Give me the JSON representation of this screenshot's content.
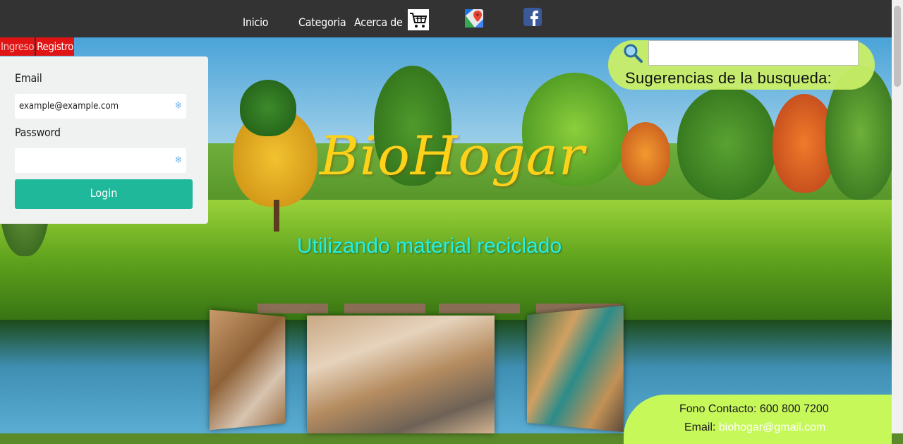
{
  "nav": {
    "items": [
      "Inicio",
      "Categoria",
      "Acerca de"
    ],
    "icons": [
      "cart-icon",
      "google-maps-icon",
      "facebook-icon"
    ]
  },
  "login": {
    "tabs": [
      "Ingreso",
      "Registro"
    ],
    "email_label": "Email",
    "email_value": "example@example.com",
    "password_label": "Password",
    "password_value": "",
    "button": "Login"
  },
  "search": {
    "value": "",
    "suggestions_label": "Sugerencias de la busqueda:"
  },
  "hero": {
    "brand": "BioHogar",
    "tagline": "Utilizando material reciclado"
  },
  "contact": {
    "phone": "Fono Contacto: 600 800 7200",
    "email_label": "Email:",
    "email": "biohogar@gmail.com"
  },
  "colors": {
    "topbar": "#333333",
    "login_button": "#1fb89a",
    "tab": "#e01414",
    "brand": "#ffd21a",
    "tagline": "#25f0e6",
    "search_bubble": "#c9ee66",
    "contact_bubble": "#c7f85a"
  }
}
